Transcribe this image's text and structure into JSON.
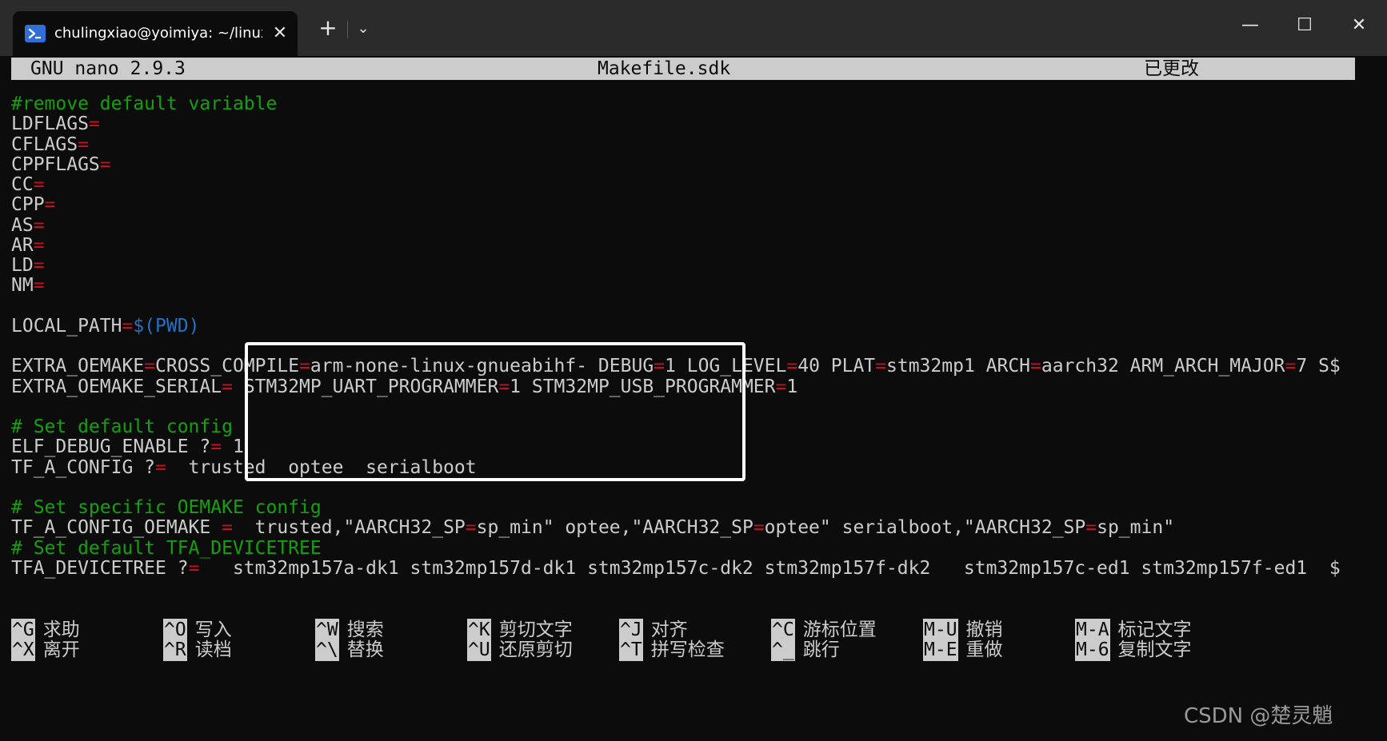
{
  "window": {
    "tab_title": "chulingxiao@yoimiya: ~/linux",
    "close_tab": "✕",
    "new_tab": "+",
    "dropdown": "⌄",
    "minimize": "—",
    "maximize": "☐",
    "close": "✕",
    "icons": {
      "tab": "powershell-terminal-icon"
    }
  },
  "nano": {
    "version": "GNU nano 2.9.3",
    "filename": "Makefile.sdk",
    "status": "已更改"
  },
  "file_lines": [
    [
      {
        "t": "#remove default variable",
        "c": "comment"
      }
    ],
    [
      {
        "t": "LDFLAGS",
        "c": "text"
      },
      {
        "t": "=",
        "c": "op"
      }
    ],
    [
      {
        "t": "CFLAGS",
        "c": "text"
      },
      {
        "t": "=",
        "c": "op"
      }
    ],
    [
      {
        "t": "CPPFLAGS",
        "c": "text"
      },
      {
        "t": "=",
        "c": "op"
      }
    ],
    [
      {
        "t": "CC",
        "c": "text"
      },
      {
        "t": "=",
        "c": "op"
      }
    ],
    [
      {
        "t": "CPP",
        "c": "text"
      },
      {
        "t": "=",
        "c": "op"
      }
    ],
    [
      {
        "t": "AS",
        "c": "text"
      },
      {
        "t": "=",
        "c": "op"
      }
    ],
    [
      {
        "t": "AR",
        "c": "text"
      },
      {
        "t": "=",
        "c": "op"
      }
    ],
    [
      {
        "t": "LD",
        "c": "text"
      },
      {
        "t": "=",
        "c": "op"
      }
    ],
    [
      {
        "t": "NM",
        "c": "text"
      },
      {
        "t": "=",
        "c": "op"
      }
    ],
    [],
    [
      {
        "t": "LOCAL_PATH",
        "c": "text"
      },
      {
        "t": "=",
        "c": "op"
      },
      {
        "t": "$(PWD)",
        "c": "var"
      }
    ],
    [],
    [
      {
        "t": "EXTRA_OEMAKE",
        "c": "text"
      },
      {
        "t": "=",
        "c": "op"
      },
      {
        "t": "CROSS_COMPILE",
        "c": "text"
      },
      {
        "t": "=",
        "c": "op"
      },
      {
        "t": "arm-none-linux-gnueabihf- DEBUG",
        "c": "text"
      },
      {
        "t": "=",
        "c": "op"
      },
      {
        "t": "1 LOG_LEVEL",
        "c": "text"
      },
      {
        "t": "=",
        "c": "op"
      },
      {
        "t": "40 PLAT",
        "c": "text"
      },
      {
        "t": "=",
        "c": "op"
      },
      {
        "t": "stm32mp1 ARCH",
        "c": "text"
      },
      {
        "t": "=",
        "c": "op"
      },
      {
        "t": "aarch32 ARM_ARCH_MAJOR",
        "c": "text"
      },
      {
        "t": "=",
        "c": "op"
      },
      {
        "t": "7 S$",
        "c": "text"
      }
    ],
    [
      {
        "t": "EXTRA_OEMAKE_SERIAL",
        "c": "text"
      },
      {
        "t": "=",
        "c": "op"
      },
      {
        "t": " STM32MP_UART_PROGRAMMER",
        "c": "text"
      },
      {
        "t": "=",
        "c": "op"
      },
      {
        "t": "1 STM32MP_USB_PROGRAMMER",
        "c": "text"
      },
      {
        "t": "=",
        "c": "op"
      },
      {
        "t": "1",
        "c": "text"
      }
    ],
    [],
    [
      {
        "t": "# Set default config",
        "c": "comment"
      }
    ],
    [
      {
        "t": "ELF_DEBUG_ENABLE ?",
        "c": "text"
      },
      {
        "t": "=",
        "c": "op"
      },
      {
        "t": " 1",
        "c": "text"
      }
    ],
    [
      {
        "t": "TF_A_CONFIG ?",
        "c": "text"
      },
      {
        "t": "=",
        "c": "op"
      },
      {
        "t": "  trusted  optee  serialboot",
        "c": "text"
      }
    ],
    [],
    [
      {
        "t": "# Set specific OEMAKE config",
        "c": "comment"
      }
    ],
    [
      {
        "t": "TF_A_CONFIG_OEMAKE ",
        "c": "text"
      },
      {
        "t": "=",
        "c": "op"
      },
      {
        "t": "  trusted,\"AARCH32_SP",
        "c": "text"
      },
      {
        "t": "=",
        "c": "op"
      },
      {
        "t": "sp_min\" optee,\"AARCH32_SP",
        "c": "text"
      },
      {
        "t": "=",
        "c": "op"
      },
      {
        "t": "optee\" serialboot,\"AARCH32_SP",
        "c": "text"
      },
      {
        "t": "=",
        "c": "op"
      },
      {
        "t": "sp_min\"",
        "c": "text"
      }
    ],
    [
      {
        "t": "# Set default TFA_DEVICETREE",
        "c": "comment"
      }
    ],
    [
      {
        "t": "TFA_DEVICETREE ?",
        "c": "text"
      },
      {
        "t": "=",
        "c": "op"
      },
      {
        "t": "   stm32mp157a-dk1 stm32mp157d-dk1 stm32mp157c-dk2 stm32mp157f-dk2   stm32mp157c-ed1 stm32mp157f-ed1  $",
        "c": "text"
      }
    ]
  ],
  "shortcuts": [
    [
      {
        "key": "^G",
        "label": "求助"
      },
      {
        "key": "^O",
        "label": "写入"
      },
      {
        "key": "^W",
        "label": "搜索"
      },
      {
        "key": "^K",
        "label": "剪切文字"
      },
      {
        "key": "^J",
        "label": "对齐"
      },
      {
        "key": "^C",
        "label": "游标位置"
      },
      {
        "key": "M-U",
        "label": "撤销"
      },
      {
        "key": "M-A",
        "label": "标记文字"
      }
    ],
    [
      {
        "key": "^X",
        "label": "离开"
      },
      {
        "key": "^R",
        "label": "读档"
      },
      {
        "key": "^\\",
        "label": "替换"
      },
      {
        "key": "^U",
        "label": "还原剪切"
      },
      {
        "key": "^T",
        "label": "拼写检查"
      },
      {
        "key": "^_",
        "label": "跳行"
      },
      {
        "key": "M-E",
        "label": "重做"
      },
      {
        "key": "M-6",
        "label": "复制文字"
      }
    ]
  ],
  "watermark": "CSDN @楚灵魈"
}
